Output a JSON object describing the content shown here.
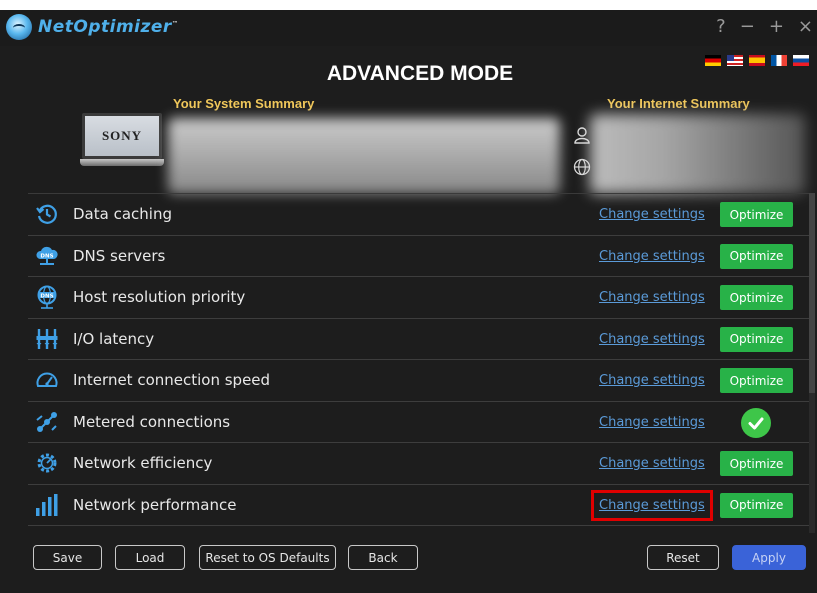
{
  "window": {
    "app_name": "NetOptimizer",
    "tm": "™",
    "controls": [
      "?",
      "−",
      "+",
      "×"
    ],
    "flags": [
      "German",
      "English",
      "Spanish",
      "French",
      "Slovenian"
    ]
  },
  "header": {
    "mode_title": "ADVANCED MODE",
    "system_summary_title": "Your System Summary",
    "internet_summary_title": "Your Internet Summary",
    "laptop_brand": "SONY"
  },
  "rows": [
    {
      "label": "Data caching",
      "link": "Change settings",
      "action": "Optimize",
      "icon": "history-icon",
      "status": "button"
    },
    {
      "label": "DNS servers",
      "link": "Change settings",
      "action": "Optimize",
      "icon": "dns-cloud-icon",
      "status": "button"
    },
    {
      "label": "Host resolution priority",
      "link": "Change settings",
      "action": "Optimize",
      "icon": "dns-globe-icon",
      "status": "button"
    },
    {
      "label": "I/O latency",
      "link": "Change settings",
      "action": "Optimize",
      "icon": "io-latency-icon",
      "status": "button"
    },
    {
      "label": "Internet connection speed",
      "link": "Change settings",
      "action": "Optimize",
      "icon": "speedometer-icon",
      "status": "button"
    },
    {
      "label": "Metered connections",
      "link": "Change settings",
      "action": "",
      "icon": "metered-icon",
      "status": "done"
    },
    {
      "label": "Network efficiency",
      "link": "Change settings",
      "action": "Optimize",
      "icon": "gear-gauge-icon",
      "status": "button"
    },
    {
      "label": "Network performance",
      "link": "Change settings",
      "action": "Optimize",
      "icon": "bar-chart-icon",
      "status": "button"
    }
  ],
  "footer": {
    "save": "Save",
    "load": "Load",
    "reset_os": "Reset to OS Defaults",
    "back": "Back",
    "reset": "Reset",
    "apply": "Apply"
  },
  "colors": {
    "accent_green": "#28b248",
    "link_blue": "#5b9bd9",
    "title_gold": "#f0c75a",
    "apply_blue": "#3a63d8",
    "highlight_red": "#e00000"
  }
}
